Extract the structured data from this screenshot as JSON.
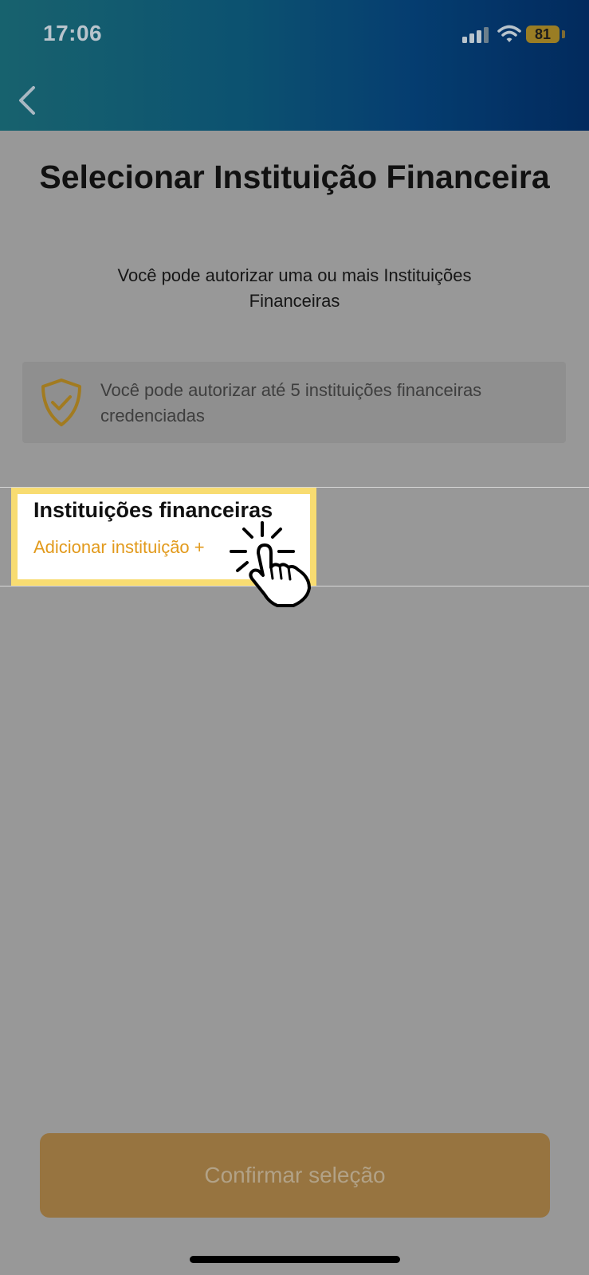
{
  "status_bar": {
    "time": "17:06",
    "battery": "81",
    "icons": [
      "signal-icon",
      "wifi-icon",
      "battery-icon"
    ]
  },
  "nav": {
    "back_icon": "chevron-left-icon"
  },
  "header": {
    "title": "Selecionar Instituição Financeira",
    "subtitle": "Você pode autorizar uma ou mais Instituições Financeiras"
  },
  "info": {
    "icon": "shield-check-icon",
    "text": "Você pode autorizar até 5 instituições financeiras credenciadas"
  },
  "institutions": {
    "section_title": "Instituições financeiras",
    "add_label": "Adicionar instituição +"
  },
  "footer": {
    "confirm_label": "Confirmar seleção"
  },
  "colors": {
    "accent": "#e29a1c",
    "highlight": "#f8dc71",
    "confirm_bg": "#977440",
    "overlay": "#989898"
  }
}
